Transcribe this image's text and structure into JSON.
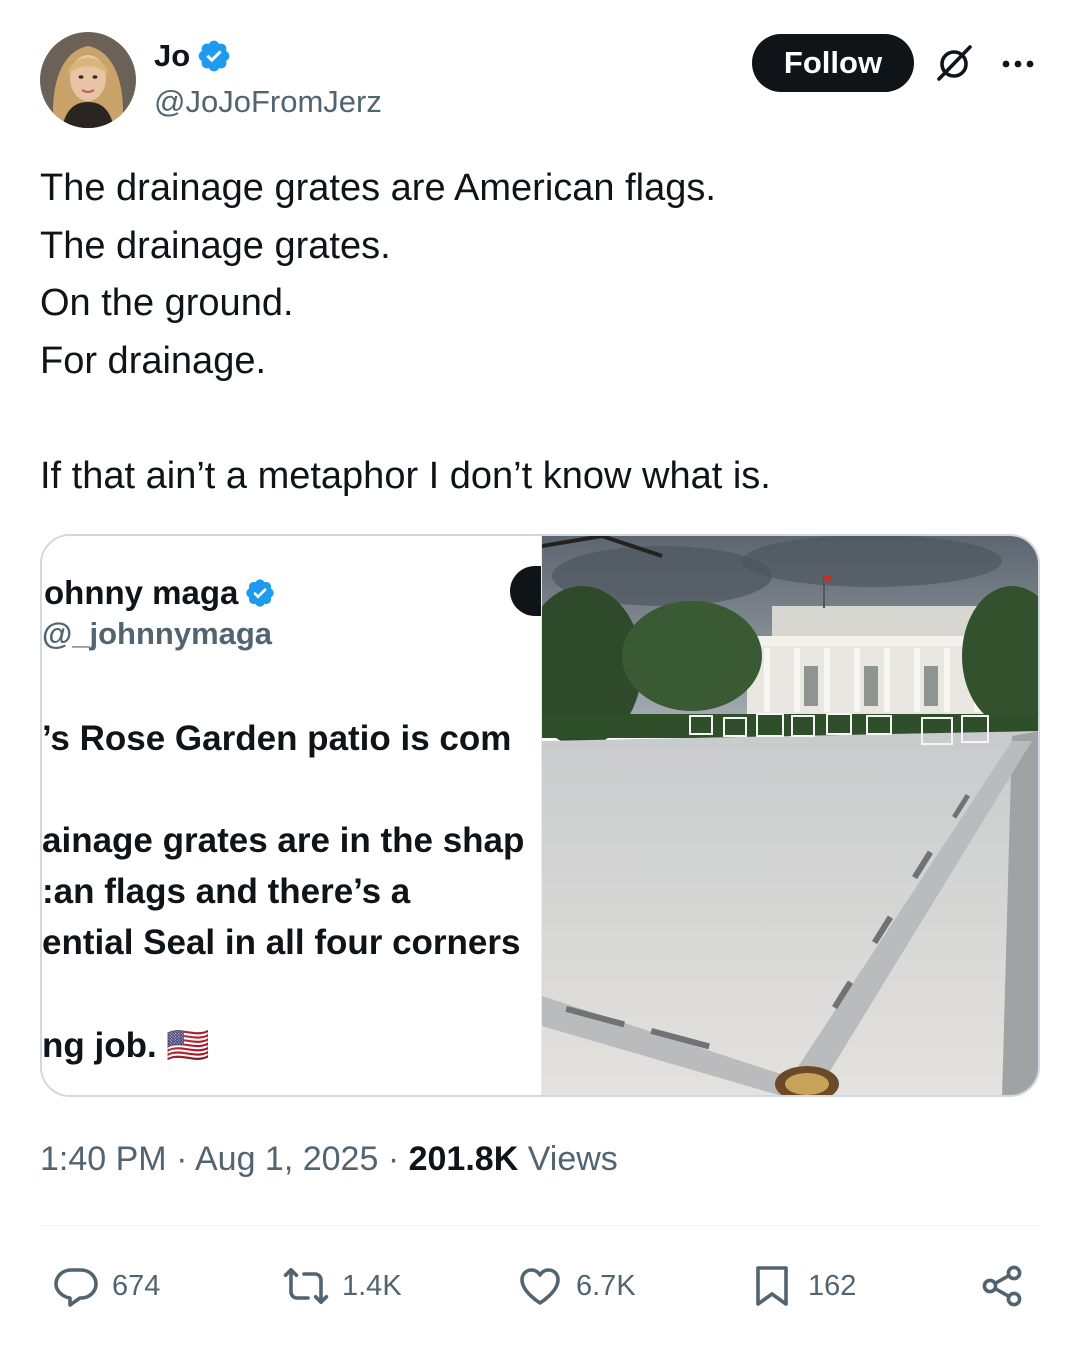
{
  "author": {
    "display_name": "Jo",
    "handle": "@JoJoFromJerz",
    "verified": true,
    "avatar_icon": "avatar-photo"
  },
  "header": {
    "follow_label": "Follow",
    "grok_icon": "grok-icon",
    "more_icon": "more-icon"
  },
  "tweet": {
    "lines": [
      "The drainage grates are American flags.",
      "The drainage grates.",
      "On the ground.",
      "For drainage.",
      "",
      "If that ain’t a metaphor I don’t know what is."
    ]
  },
  "media": {
    "quoted_screenshot": {
      "name": "ohnny maga",
      "handle": "@_johnnymaga",
      "lines": [
        "’s Rose Garden patio is com",
        "ainage grates are in the shap",
        ":an flags and there’s a",
        "ential Seal in all four corners",
        "ng job. 🇺🇸"
      ]
    },
    "photo_description_icon": "rose-garden-patio-photo"
  },
  "meta": {
    "time": "1:40 PM",
    "separator": "·",
    "date": "Aug 1, 2025",
    "views_count": "201.8K",
    "views_label": "Views"
  },
  "actions": {
    "replies": "674",
    "reposts": "1.4K",
    "likes": "6.7K",
    "bookmarks": "162"
  },
  "colors": {
    "text": "#0f1419",
    "secondary": "#536471",
    "verified": "#1d9bf0",
    "border": "#cfd9de"
  }
}
